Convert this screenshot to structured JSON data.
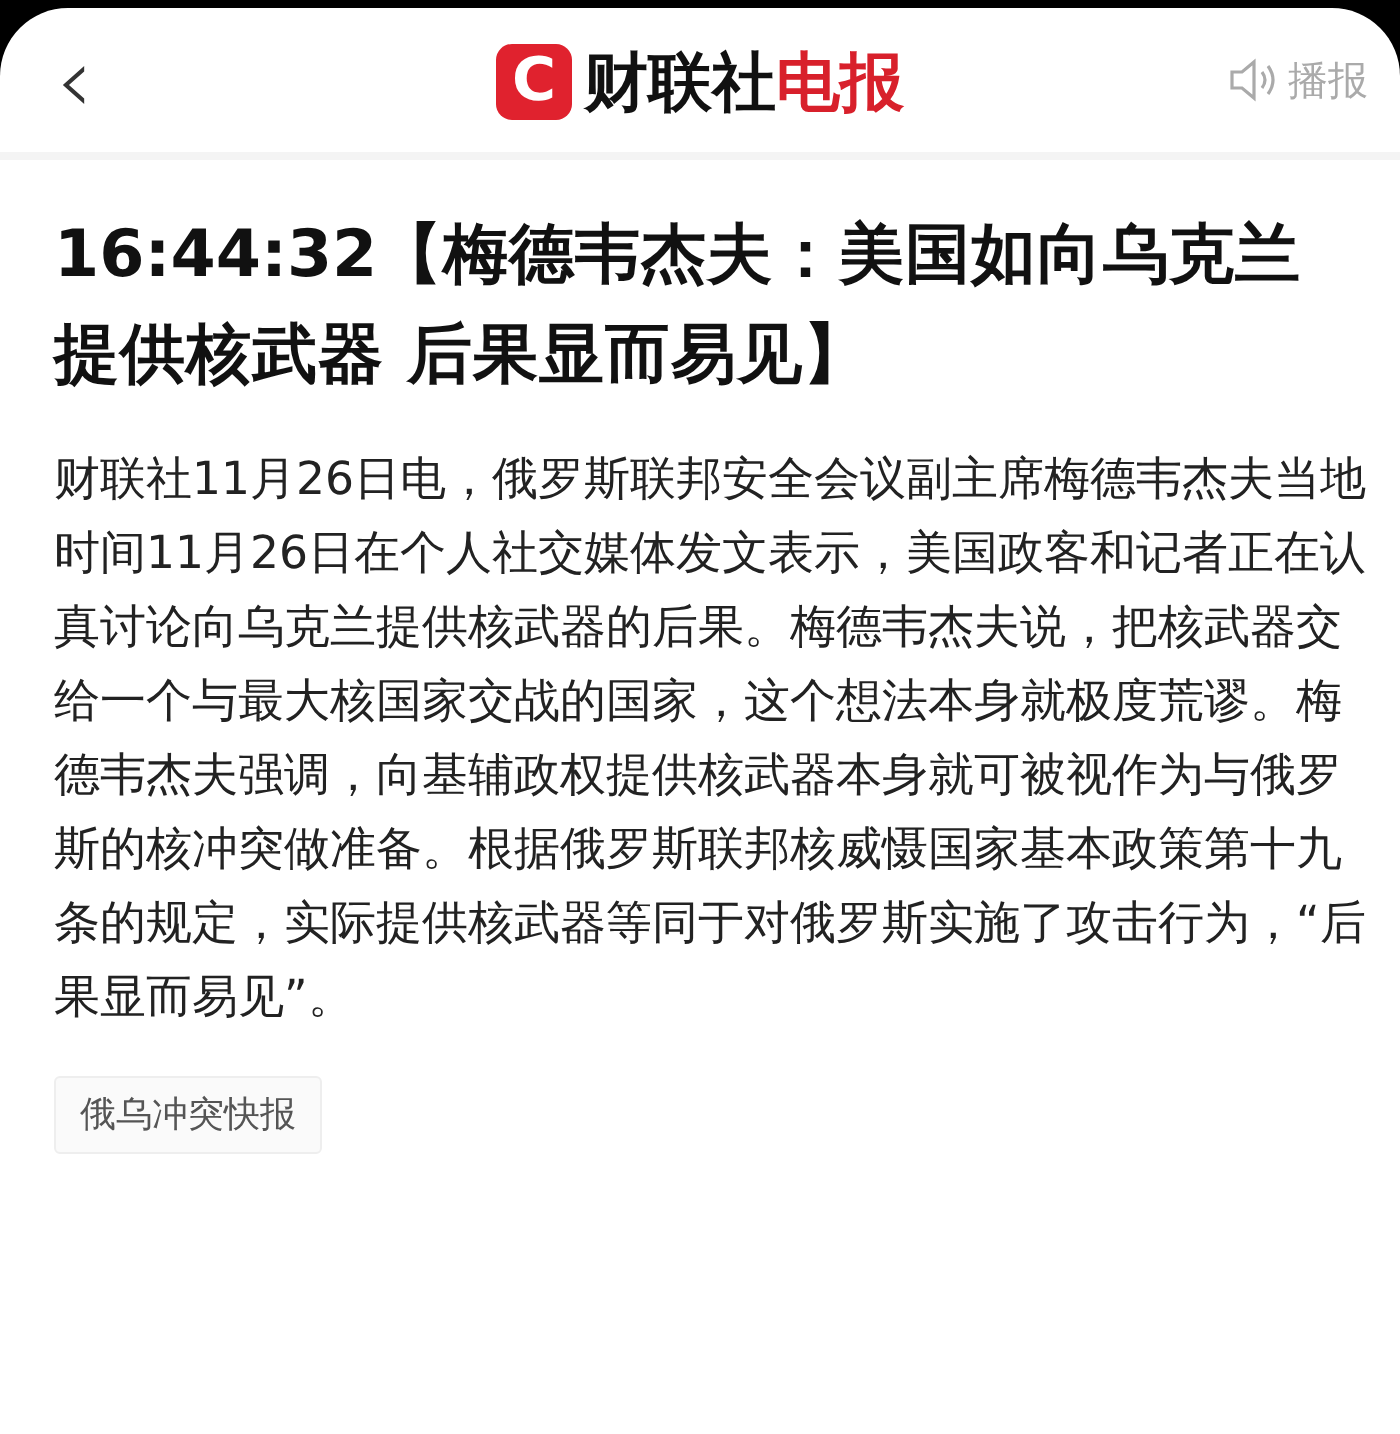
{
  "header": {
    "back": "‹",
    "logo_letter": "C",
    "brand_main": "财联社",
    "brand_accent": "电报",
    "broadcast": "播报"
  },
  "article": {
    "title": "16:44:32【梅德韦杰夫：美国如向乌克兰提供核武器 后果显而易见】",
    "body": "财联社11月26日电，俄罗斯联邦安全会议副主席梅德韦杰夫当地时间11月26日在个人社交媒体发文表示，美国政客和记者正在认真讨论向乌克兰提供核武器的后果。梅德韦杰夫说，把核武器交给一个与最大核国家交战的国家，这个想法本身就极度荒谬。梅德韦杰夫强调，向基辅政权提供核武器本身就可被视作为与俄罗斯的核冲突做准备。根据俄罗斯联邦核威慑国家基本政策第十九条的规定，实际提供核武器等同于对俄罗斯实施了攻击行为，“后果显而易见”。",
    "tags": [
      "俄乌冲突快报"
    ]
  }
}
